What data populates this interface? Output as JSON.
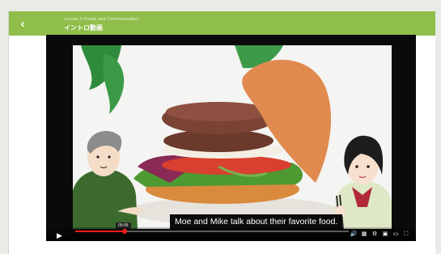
{
  "header": {
    "breadcrumb": "Lesson 5  Foods and Communication",
    "title": "イントロ動画",
    "back_icon": "chevron-left-icon"
  },
  "video": {
    "caption": "Moe and Mike talk about their favorite food.",
    "current_time": "00:05",
    "progress_fraction": 0.18,
    "accent_color": "#ff1a1a"
  },
  "controls": {
    "play_icon": "play-icon",
    "volume_icon": "volume-icon",
    "subtitles_icon": "subtitles-icon",
    "settings_icon": "gear-icon",
    "miniplayer_icon": "miniplayer-icon",
    "theater_icon": "theater-icon",
    "fullscreen_icon": "fullscreen-icon"
  },
  "colors": {
    "header_green": "#8fbe4a"
  }
}
